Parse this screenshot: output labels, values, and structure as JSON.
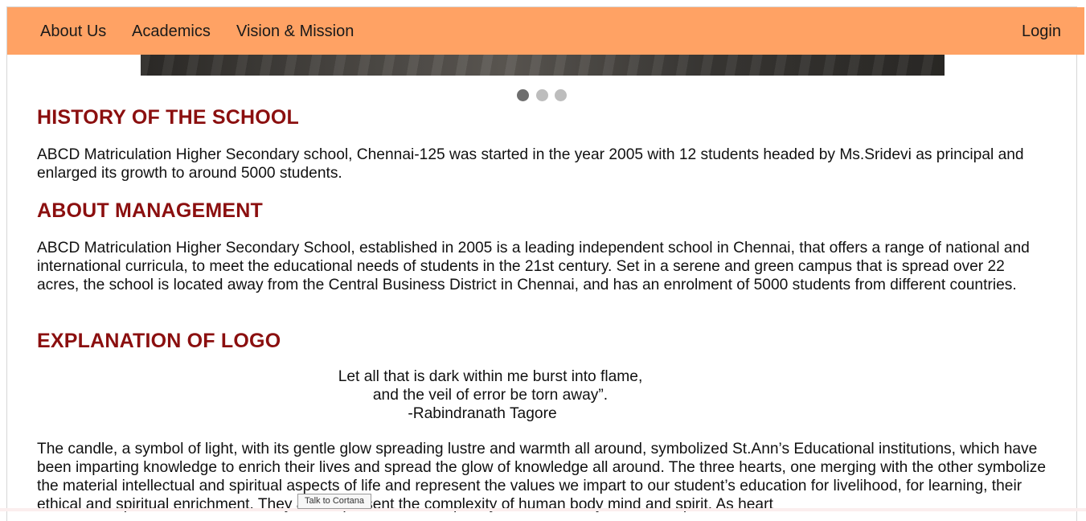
{
  "nav": {
    "links": [
      "About Us",
      "Academics",
      "Vision & Mission"
    ],
    "login": "Login"
  },
  "carousel": {
    "slide_count": 3,
    "active_index": 0
  },
  "sections": {
    "history": {
      "heading": "HISTORY OF THE SCHOOL",
      "text": "ABCD Matriculation Higher Secondary school, Chennai-125 was started in the year 2005 with 12 students headed by Ms.Sridevi as principal and enlarged its growth to around 5000 students."
    },
    "management": {
      "heading": "ABOUT MANAGEMENT",
      "text": "ABCD Matriculation Higher Secondary School, established in 2005 is a leading independent school in Chennai, that offers a range of national and international curricula, to meet the educational needs of students in the 21st century. Set in a serene and green campus that is spread over 22 acres, the school is located away from the Central Business District in Chennai, and has an enrolment of 5000 students from different countries."
    },
    "logo": {
      "heading": "EXPLANATION OF LOGO",
      "quote_lines": [
        "Let all that is dark within me burst into flame,",
        "and the veil of error be torn away”.",
        "-Rabindranath Tagore"
      ],
      "text": "The candle, a symbol of light, with its gentle glow spreading lustre and warmth all around, symbolized St.Ann’s Educational institutions, which have been imparting knowledge to enrich their lives and spread the glow of knowledge all around. The three hearts, one merging with the other symbolize the material intellectual and spiritual aspects of life and represent the values we impart to our student’s education for livelihood, for learning, their ethical and spiritual enrichment. They also represent the complexity of human body mind and spirit. As heart"
    }
  },
  "tooltip": {
    "text": "Talk to Cortana"
  },
  "colors": {
    "navbar": "#ffa264",
    "heading": "#8b0f0f",
    "dot_active": "#6e6e6e",
    "dot_inactive": "#bdbdbd"
  }
}
